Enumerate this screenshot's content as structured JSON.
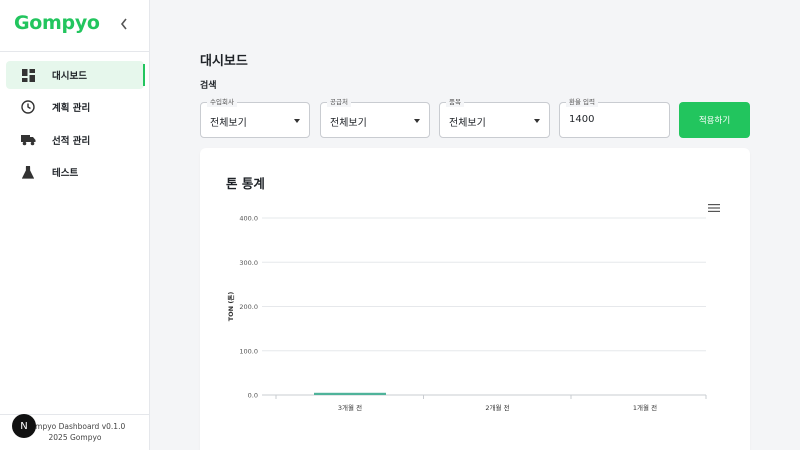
{
  "app": {
    "logo": "Gompyo"
  },
  "sidebar": {
    "items": [
      {
        "label": "대시보드",
        "icon": "dashboard-icon",
        "active": true
      },
      {
        "label": "계획 관리",
        "icon": "clock-icon",
        "active": false
      },
      {
        "label": "선적 관리",
        "icon": "truck-icon",
        "active": false
      },
      {
        "label": "테스트",
        "icon": "flask-icon",
        "active": false
      }
    ],
    "footer_line1": "Gompyo Dashboard v0.1.0",
    "footer_line2": "2025 Gompyo",
    "badge": "N"
  },
  "main": {
    "title": "대시보드",
    "search_label": "검색",
    "filters": [
      {
        "label": "수입회사",
        "value": "전체보기"
      },
      {
        "label": "공급처",
        "value": "전체보기"
      },
      {
        "label": "품목",
        "value": "전체보기"
      }
    ],
    "rate_field": {
      "label": "환율 입력",
      "value": "1400"
    },
    "apply_label": "적용하기"
  },
  "colors": {
    "accent": "#22c55e",
    "bar": "#4fb39a"
  },
  "chart_data": {
    "type": "bar",
    "title": "톤 통계",
    "ylabel": "TON (톤)",
    "xlabel": "",
    "categories": [
      "3개월 전",
      "2개월 전",
      "1개월 전"
    ],
    "values": [
      5,
      0,
      0
    ],
    "ylim": [
      0,
      400
    ],
    "yticks": [
      "0.0",
      "100.0",
      "200.0",
      "300.0",
      "400.0"
    ],
    "grid": true
  }
}
